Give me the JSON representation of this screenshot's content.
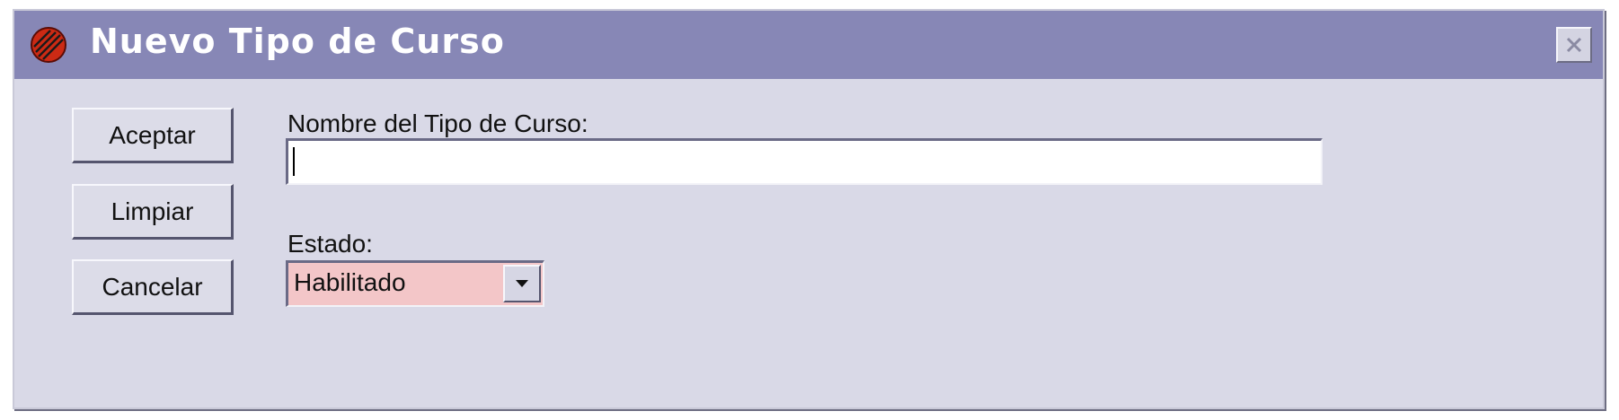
{
  "window": {
    "title": "Nuevo Tipo de Curso",
    "title_bar_color": "#8787b6",
    "background_color": "#d9d9e7",
    "app_icon": "red-disc-app-icon",
    "close_icon": "close-x-icon"
  },
  "buttons": {
    "accept_label": "Aceptar",
    "clear_label": "Limpiar",
    "cancel_label": "Cancelar"
  },
  "form": {
    "name_label": "Nombre del Tipo de Curso:",
    "name_value": "",
    "state_label": "Estado:",
    "state_value": "Habilitado",
    "state_field_color": "#f3c6c8",
    "dropdown_icon": "chevron-down-icon"
  }
}
